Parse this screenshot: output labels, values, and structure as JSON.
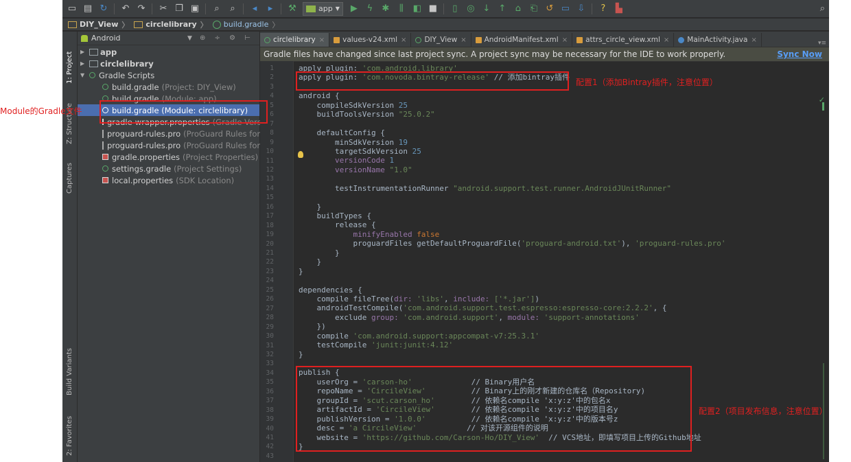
{
  "toolbar": {
    "run_config": "app",
    "icons": [
      "open-icon",
      "save-icon",
      "sync-icon",
      "undo-icon",
      "redo-icon",
      "cut-icon",
      "copy-icon",
      "paste-icon",
      "find-icon",
      "replace-icon",
      "back-icon",
      "forward-icon",
      "make-icon",
      "run-icon",
      "debug-icon",
      "attach-icon",
      "coverage-icon",
      "profile-icon",
      "stop-icon",
      "avd-icon",
      "gradle-sync-icon",
      "vcs-update-icon",
      "vcs-commit-icon",
      "vcs-history-icon",
      "vcs-revert-icon",
      "sdk-icon",
      "device-monitor-icon",
      "help-icon",
      "terminal-icon",
      "search-icon"
    ]
  },
  "navbar": {
    "crumbs": [
      "DIY_View",
      "circlelibrary",
      "build.gradle"
    ]
  },
  "toolstrip": {
    "project": "1: Project",
    "structure": "Z: Structure",
    "captures": "Captures",
    "build_variants": "Build Variants",
    "favorites": "2: Favorites"
  },
  "project": {
    "view_mode": "Android",
    "tree": [
      {
        "label": "app",
        "hint": ""
      },
      {
        "label": "circlelibrary",
        "hint": ""
      },
      {
        "label": "Gradle Scripts",
        "hint": ""
      },
      {
        "label": "build.gradle",
        "hint": "(Project: DIY_View)"
      },
      {
        "label": "build.gradle",
        "hint": "(Module: app)"
      },
      {
        "label": "build.gradle (Module: circlelibrary)",
        "hint": ""
      },
      {
        "label": "gradle-wrapper.properties",
        "hint": "(Gradle Versio"
      },
      {
        "label": "proguard-rules.pro",
        "hint": "(ProGuard Rules for ap"
      },
      {
        "label": "proguard-rules.pro",
        "hint": "(ProGuard Rules for ci"
      },
      {
        "label": "gradle.properties",
        "hint": "(Project Properties)"
      },
      {
        "label": "settings.gradle",
        "hint": "(Project Settings)"
      },
      {
        "label": "local.properties",
        "hint": "(SDK Location)"
      }
    ]
  },
  "tabs": [
    {
      "label": "circlelibrary"
    },
    {
      "label": "values-v24.xml"
    },
    {
      "label": "DIY_View"
    },
    {
      "label": "AndroidManifest.xml"
    },
    {
      "label": "attrs_circle_view.xml"
    },
    {
      "label": "MainActivity.java"
    }
  ],
  "banner": {
    "message": "Gradle files have changed since last project sync. A project sync may be necessary for the IDE to work properly.",
    "action": "Sync Now"
  },
  "code": {
    "line_numbers": [
      "1",
      "2",
      "3",
      "4",
      "5",
      "6",
      "7",
      "8",
      "9",
      "10",
      "11",
      "12",
      "13",
      "14",
      "15",
      "16",
      "17",
      "18",
      "19",
      "20",
      "21",
      "22",
      "23",
      "24",
      "25",
      "26",
      "27",
      "28",
      "29",
      "30",
      "31",
      "32",
      "33",
      "34",
      "35",
      "36",
      "37",
      "38",
      "39",
      "40",
      "41",
      "42",
      "43"
    ],
    "l1": [
      "apply plugin: ",
      "'com.android.library'"
    ],
    "l2": [
      "apply plugin: ",
      "'com.novoda.bintray-release'",
      " // 添加bintray插件"
    ],
    "l4": "android {",
    "l5": [
      "    compileSdkVersion ",
      "25"
    ],
    "l6": [
      "    buildToolsVersion ",
      "\"25.0.2\""
    ],
    "l8": "    defaultConfig {",
    "l9": [
      "        minSdkVersion ",
      "19"
    ],
    "l10": [
      "        targetSdkVersion ",
      "25"
    ],
    "l11": [
      "        versionCode ",
      "1"
    ],
    "l12": [
      "        versionName ",
      "\"1.0\""
    ],
    "l14": [
      "        testInstrumentationRunner ",
      "\"android.support.test.runner.AndroidJUnitRunner\""
    ],
    "l16": "    }",
    "l17": "    buildTypes {",
    "l18": "        release {",
    "l19": [
      "            minifyEnabled ",
      "false"
    ],
    "l20": [
      "            proguardFiles getDefaultProguardFile(",
      "'proguard-android.txt'",
      "), ",
      "'proguard-rules.pro'"
    ],
    "l21": "        }",
    "l22": "    }",
    "l23": "}",
    "l25": "dependencies {",
    "l26": [
      "    compile fileTree(",
      "dir: ",
      "'libs'",
      ", ",
      "include: ",
      "['*.jar']",
      ")"
    ],
    "l27": [
      "    androidTestCompile(",
      "'com.android.support.test.espresso:espresso-core:2.2.2'",
      ", {"
    ],
    "l28": [
      "        exclude ",
      "group: ",
      "'com.android.support'",
      ", ",
      "module: ",
      "'support-annotations'"
    ],
    "l29": "    })",
    "l30": [
      "    compile ",
      "'com.android.support:appcompat-v7:25.3.1'"
    ],
    "l31": [
      "    testCompile ",
      "'junit:junit:4.12'"
    ],
    "l32": "}",
    "l34": "publish {",
    "l35": [
      "    userOrg = ",
      "'carson-ho'",
      "             // Binary用户名"
    ],
    "l36": [
      "    repoName = ",
      "'CircileView'",
      "          // Binary上的刚才新建的仓库名（Repository)"
    ],
    "l37": [
      "    groupId = ",
      "'scut.carson_ho'",
      "        // 依赖名compile 'x:y:z'中的包名x"
    ],
    "l38": [
      "    artifactId = ",
      "'CircileView'",
      "        // 依赖名compile 'x:y:z'中的项目名y"
    ],
    "l39": [
      "    publishVersion = ",
      "'1.0.0'",
      "          // 依赖名compile 'x:y:z'中的版本号z"
    ],
    "l40": [
      "    desc = ",
      "'a CircileView'",
      "           // 对该开源组件的说明"
    ],
    "l41": [
      "    website = ",
      "'https://github.com/Carson-Ho/DIY_View'",
      "  // VCS地址，即填写项目上传的Github地址"
    ],
    "l42": "}"
  },
  "annotations": {
    "module_label": "Module的Gradle文件",
    "config1": "配置1（添加Bintray插件，注意位置）",
    "config2": "配置2（项目发布信息，注意位置）"
  }
}
